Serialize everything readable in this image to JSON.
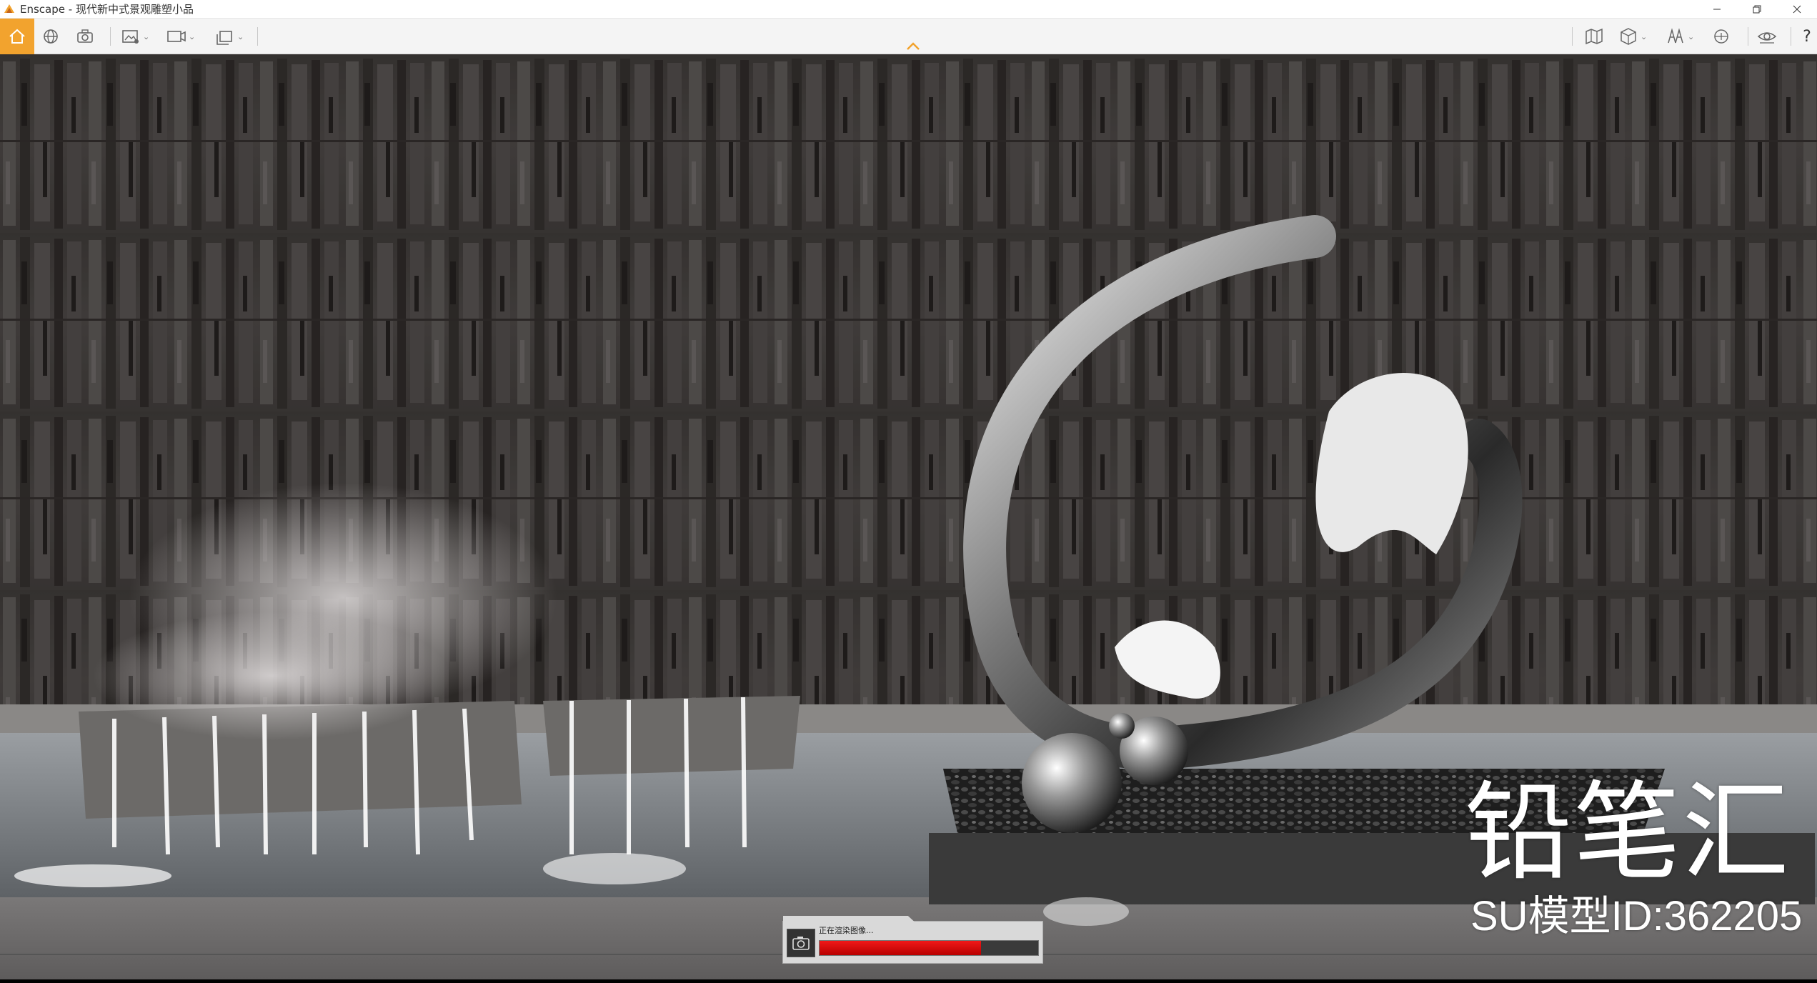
{
  "window": {
    "app_name": "Enscape",
    "separator": " - ",
    "document_title": "现代新中式景观雕塑小品"
  },
  "toolbar": {
    "left_buttons": [
      "home-icon",
      "globe-orbit-icon",
      "camera-screenshot-icon",
      "render-image-icon",
      "video-render-icon",
      "batch-render-icon"
    ],
    "right_buttons": [
      "map-icon",
      "cube-asset-icon",
      "visual-settings-icon",
      "collaborate-icon",
      "eye-view-icon",
      "help-icon"
    ],
    "help_label": "?",
    "accent_color": "#f2a32e"
  },
  "viewport": {
    "watermark_brand": "铅笔汇",
    "watermark_id": "SU模型ID:362205"
  },
  "render_progress": {
    "label": "正在渲染图像...",
    "progress": 0.74,
    "fill_color": "#e01010"
  }
}
